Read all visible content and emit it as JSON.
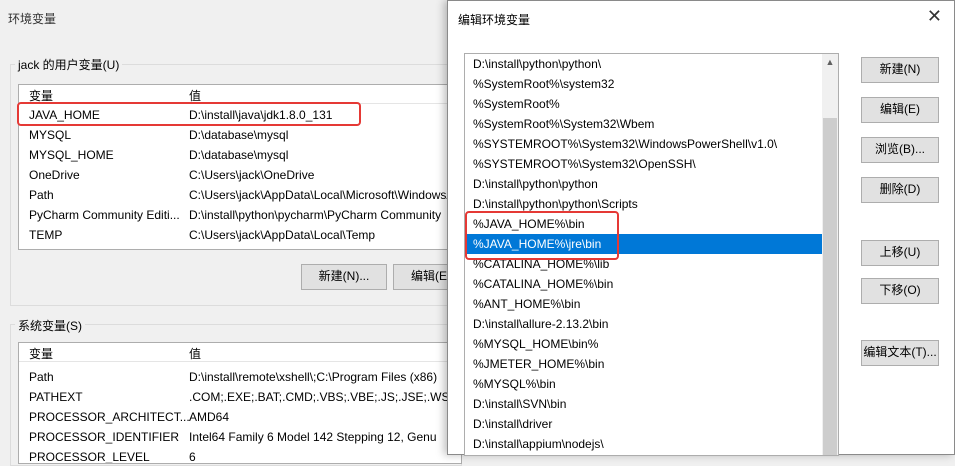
{
  "bg_window": {
    "title": "环境变量",
    "user_vars": {
      "group_label": "jack 的用户变量(U)",
      "col_variable": "变量",
      "col_value": "值",
      "rows": [
        {
          "name": "JAVA_HOME",
          "value": "D:\\install\\java\\jdk1.8.0_131"
        },
        {
          "name": "MYSQL",
          "value": "D:\\database\\mysql"
        },
        {
          "name": "MYSQL_HOME",
          "value": "D:\\database\\mysql"
        },
        {
          "name": "OneDrive",
          "value": "C:\\Users\\jack\\OneDrive"
        },
        {
          "name": "Path",
          "value": "C:\\Users\\jack\\AppData\\Local\\Microsoft\\WindowsApps"
        },
        {
          "name": "PyCharm Community Editi...",
          "value": "D:\\install\\python\\pycharm\\PyCharm Community"
        },
        {
          "name": "TEMP",
          "value": "C:\\Users\\jack\\AppData\\Local\\Temp"
        }
      ],
      "new_button": "新建(N)...",
      "edit_button": "编辑(E)..."
    },
    "system_vars": {
      "group_label": "系统变量(S)",
      "col_variable": "变量",
      "col_value": "值",
      "rows": [
        {
          "name": "Path",
          "value": "D:\\install\\remote\\xshell\\;C:\\Program Files (x86)"
        },
        {
          "name": "PATHEXT",
          "value": ".COM;.EXE;.BAT;.CMD;.VBS;.VBE;.JS;.JSE;.WSF;.W"
        },
        {
          "name": "PROCESSOR_ARCHITECT...",
          "value": "AMD64"
        },
        {
          "name": "PROCESSOR_IDENTIFIER",
          "value": "Intel64 Family 6 Model 142 Stepping 12, Genu"
        },
        {
          "name": "PROCESSOR_LEVEL",
          "value": "6"
        }
      ]
    }
  },
  "edit_dialog": {
    "title": "编辑环境变量",
    "close": "✕",
    "paths": [
      "D:\\install\\python\\python\\",
      "%SystemRoot%\\system32",
      "%SystemRoot%",
      "%SystemRoot%\\System32\\Wbem",
      "%SYSTEMROOT%\\System32\\WindowsPowerShell\\v1.0\\",
      "%SYSTEMROOT%\\System32\\OpenSSH\\",
      "D:\\install\\python\\python",
      "D:\\install\\python\\python\\Scripts",
      "%JAVA_HOME%\\bin",
      "%JAVA_HOME%\\jre\\bin",
      "%CATALINA_HOME%\\lib",
      "%CATALINA_HOME%\\bin",
      "%ANT_HOME%\\bin",
      "D:\\install\\allure-2.13.2\\bin",
      "%MYSQL_HOME\\bin%",
      "%JMETER_HOME%\\bin",
      "%MYSQL%\\bin",
      "D:\\install\\SVN\\bin",
      "D:\\install\\driver",
      "D:\\install\\appium\\nodejs\\"
    ],
    "selected_index": 9,
    "buttons": {
      "new": "新建(N)",
      "edit": "编辑(E)",
      "browse": "浏览(B)...",
      "delete": "删除(D)",
      "move_up": "上移(U)",
      "move_down": "下移(O)",
      "edit_text": "编辑文本(T)..."
    }
  }
}
